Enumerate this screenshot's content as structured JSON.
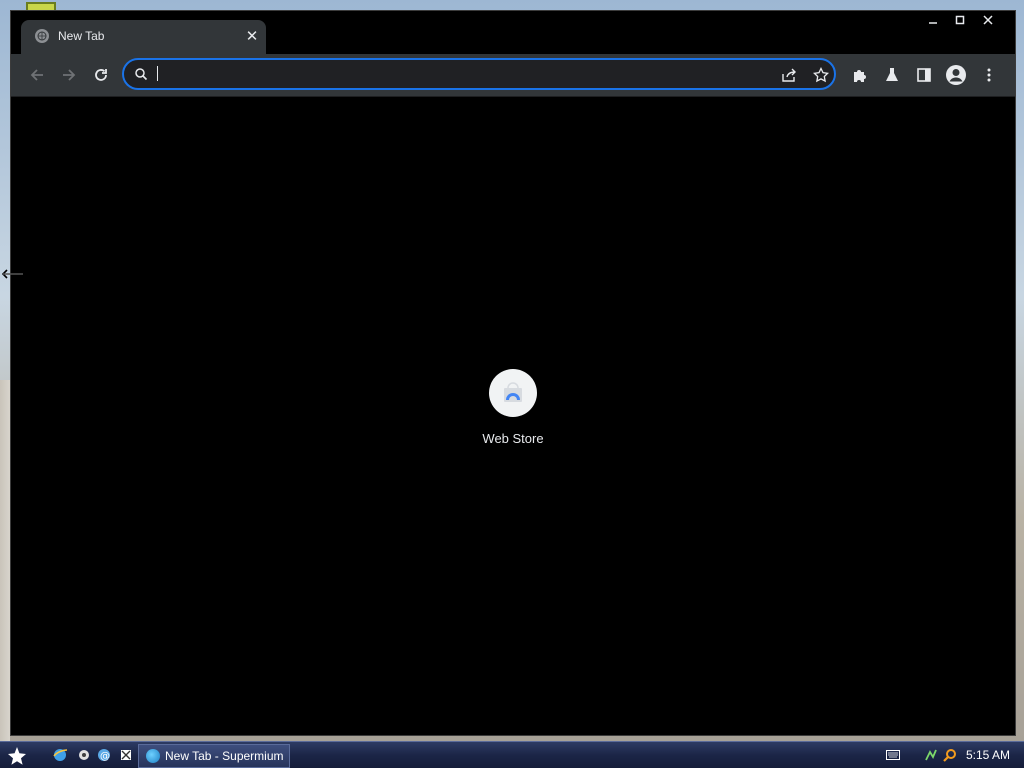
{
  "browser": {
    "tab": {
      "title": "New Tab",
      "close_symbol": "✕"
    },
    "window_controls": {
      "minimize": "—",
      "maximize": "□",
      "close": "✕"
    },
    "omnibox": {
      "value": "",
      "placeholder": ""
    },
    "shortcuts": [
      {
        "label": "Web Store"
      }
    ],
    "accent_color": "#1a73e8"
  },
  "taskbar": {
    "task_item": {
      "label": "New Tab - Supermium"
    },
    "clock": "5:15 AM"
  },
  "icons": {
    "back": "arrow-left-icon",
    "forward": "arrow-right-icon",
    "reload": "reload-icon",
    "search": "search-icon",
    "share": "share-icon",
    "bookmark": "star-icon",
    "extensions": "puzzle-icon",
    "labs": "flask-icon",
    "side_panel": "side-panel-icon",
    "profile": "profile-icon",
    "menu": "kebab-menu-icon"
  }
}
